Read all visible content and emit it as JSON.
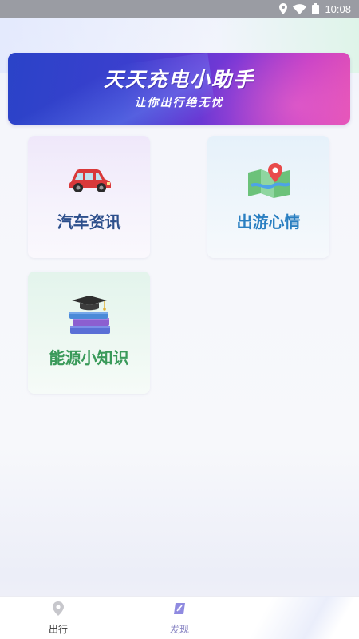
{
  "status_bar": {
    "time": "10:08",
    "icons": [
      "location-icon",
      "wifi-icon",
      "battery-icon"
    ]
  },
  "banner": {
    "title": "天天充电小助手",
    "subtitle": "让你出行绝无忧"
  },
  "cards": {
    "car_news": {
      "label": "汽车资讯",
      "icon": "car-icon"
    },
    "travel_mood": {
      "label": "出游心情",
      "icon": "map-icon"
    },
    "energy_tips": {
      "label": "能源小知识",
      "icon": "books-icon"
    }
  },
  "tabbar": {
    "travel": {
      "label": "出行",
      "icon": "location-pin-icon"
    },
    "discover": {
      "label": "发现",
      "icon": "discover-icon"
    },
    "active": "discover"
  },
  "colors": {
    "banner_start": "#2a43c8",
    "banner_end": "#e24fb6",
    "car_label": "#2d4f8c",
    "travel_label": "#2a7fc1",
    "energy_label": "#3a9a5a",
    "active_tab": "#8a86c4"
  }
}
